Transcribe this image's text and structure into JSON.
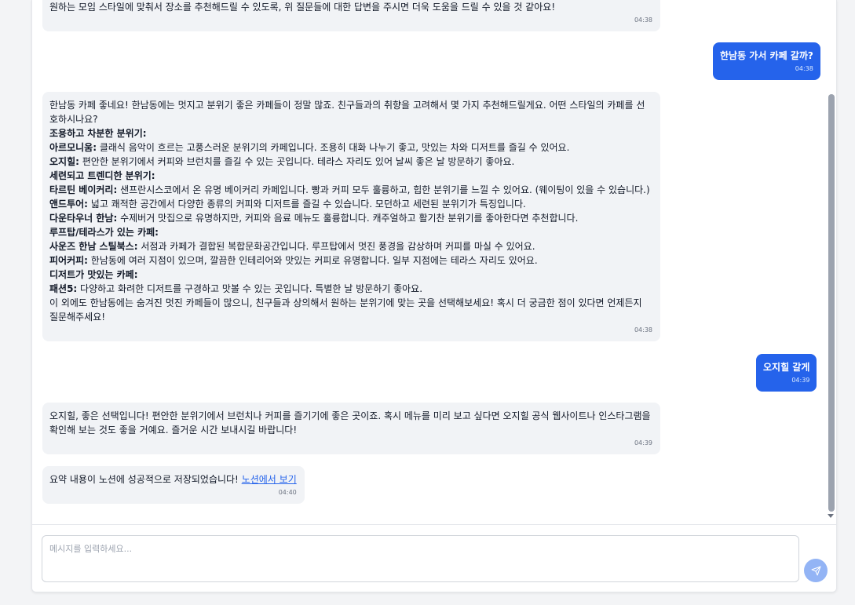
{
  "messages": {
    "m1": {
      "text": "원하는 모임 스타일에 맞춰서 장소를 추천해드릴 수 있도록, 위 질문들에 대한 답변을 주시면 더욱 도움을 드릴 수 있을 것 같아요!",
      "time": "04:38"
    },
    "m2": {
      "text": "한남동 가서 카페 갈까?",
      "time": "04:38"
    },
    "m3": {
      "intro": "한남동 카페 좋네요! 한남동에는 멋지고 분위기 좋은 카페들이 정말 많죠. 친구들과의 취향을 고려해서 몇 가지 추천해드릴게요. 어떤 스타일의 카페를 선호하시나요?",
      "section1": "조용하고 차분한 분위기:",
      "cafe1_name": "아르모니움:",
      "cafe1_desc": " 클래식 음악이 흐르는 고풍스러운 분위기의 카페입니다. 조용히 대화 나누기 좋고, 맛있는 차와 디저트를 즐길 수 있어요.",
      "cafe2_name": "오지힐:",
      "cafe2_desc": " 편안한 분위기에서 커피와 브런치를 즐길 수 있는 곳입니다. 테라스 자리도 있어 날씨 좋은 날 방문하기 좋아요.",
      "section2": "세련되고 트렌디한 분위기:",
      "cafe3_name": "타르틴 베이커리:",
      "cafe3_desc": " 샌프란시스코에서 온 유명 베이커리 카페입니다. 빵과 커피 모두 훌륭하고, 힙한 분위기를 느낄 수 있어요. (웨이팅이 있을 수 있습니다.)",
      "cafe4_name": "앤드투어:",
      "cafe4_desc": " 넓고 쾌적한 공간에서 다양한 종류의 커피와 디저트를 즐길 수 있습니다. 모던하고 세련된 분위기가 특징입니다.",
      "cafe5_name": "다운타우너 한남:",
      "cafe5_desc": " 수제버거 맛집으로 유명하지만, 커피와 음료 메뉴도 훌륭합니다. 캐주얼하고 활기찬 분위기를 좋아한다면 추천합니다.",
      "section3": "루프탑/테라스가 있는 카페:",
      "cafe6_name": "사운즈 한남 스틸북스:",
      "cafe6_desc": " 서점과 카페가 결합된 복합문화공간입니다. 루프탑에서 멋진 풍경을 감상하며 커피를 마실 수 있어요.",
      "cafe7_name": "피어커피:",
      "cafe7_desc": " 한남동에 여러 지점이 있으며, 깔끔한 인테리어와 맛있는 커피로 유명합니다. 일부 지점에는 테라스 자리도 있어요.",
      "section4": "디저트가 맛있는 카페:",
      "cafe8_name": "패션5:",
      "cafe8_desc": " 다양하고 화려한 디저트를 구경하고 맛볼 수 있는 곳입니다. 특별한 날 방문하기 좋아요.",
      "outro": "이 외에도 한남동에는 숨겨진 멋진 카페들이 많으니, 친구들과 상의해서 원하는 분위기에 맞는 곳을 선택해보세요! 혹시 더 궁금한 점이 있다면 언제든지 질문해주세요!",
      "time": "04:38"
    },
    "m4": {
      "text": "오지힐 갈게",
      "time": "04:39"
    },
    "m5": {
      "text": "오지힐, 좋은 선택입니다! 편안한 분위기에서 브런치나 커피를 즐기기에 좋은 곳이죠. 혹시 메뉴를 미리 보고 싶다면 오지힐 공식 웹사이트나 인스타그램을 확인해 보는 것도 좋을 거예요. 즐거운 시간 보내시길 바랍니다!",
      "time": "04:39"
    },
    "m6": {
      "text": "요약 내용이 노션에 성공적으로 저장되었습니다! ",
      "link": "노션에서 보기",
      "time": "04:40"
    }
  },
  "composer": {
    "placeholder": "메시지를 입력하세요..."
  },
  "colors": {
    "user_bubble": "#2563eb",
    "bot_bubble": "#f1f3f6",
    "send_button": "#93b4f5"
  },
  "icons": {
    "send": "send-icon"
  }
}
